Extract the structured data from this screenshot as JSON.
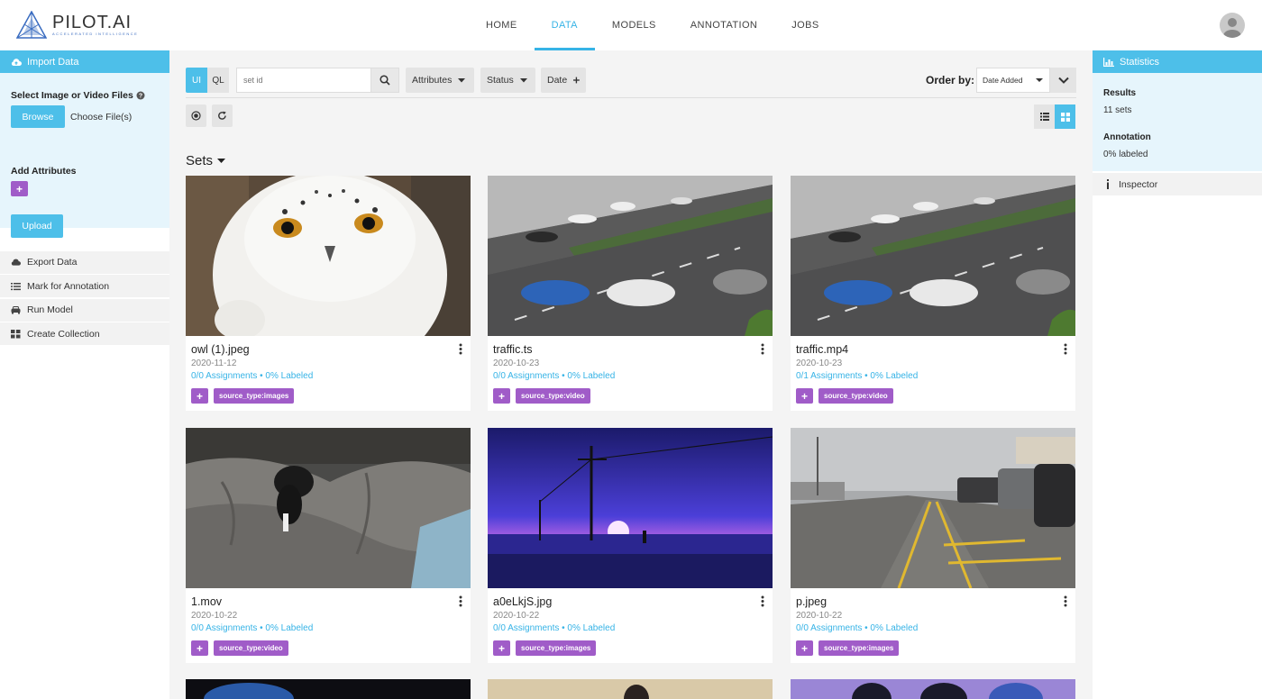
{
  "app": {
    "title": "PILOT.AI",
    "subtitle": "ACCELERATED INTELLIGENCE"
  },
  "nav": [
    {
      "label": "HOME"
    },
    {
      "label": "DATA"
    },
    {
      "label": "MODELS"
    },
    {
      "label": "ANNOTATION"
    },
    {
      "label": "JOBS"
    }
  ],
  "left": {
    "import_label": "Import Data",
    "select_label": "Select Image or Video Files",
    "browse_label": "Browse",
    "choose_label": "Choose File(s)",
    "add_attr_label": "Add Attributes",
    "add_attr_plus": "+",
    "upload_label": "Upload",
    "items": [
      {
        "label": "Export Data",
        "icon": "cloud-download-icon"
      },
      {
        "label": "Mark for Annotation",
        "icon": "list-icon"
      },
      {
        "label": "Run Model",
        "icon": "car-icon"
      },
      {
        "label": "Create Collection",
        "icon": "grid-icon"
      }
    ]
  },
  "toolbar": {
    "mode_ui": "UI",
    "mode_ql": "QL",
    "search_placeholder": "set id",
    "attributes_label": "Attributes",
    "status_label": "Status",
    "date_label": "Date",
    "order_label": "Order by:",
    "order_value": "Date Added"
  },
  "sets_heading": "Sets",
  "cards": [
    {
      "title": "owl (1).jpeg",
      "date": "2020-11-12",
      "stats": "0/0 Assignments • 0% Labeled",
      "tag": "source_type:images",
      "plus": "+"
    },
    {
      "title": "traffic.ts",
      "date": "2020-10-23",
      "stats": "0/0 Assignments • 0% Labeled",
      "tag": "source_type:video",
      "plus": "+"
    },
    {
      "title": "traffic.mp4",
      "date": "2020-10-23",
      "stats": "0/1 Assignments • 0% Labeled",
      "tag": "source_type:video",
      "plus": "+"
    },
    {
      "title": "1.mov",
      "date": "2020-10-22",
      "stats": "0/0 Assignments • 0% Labeled",
      "tag": "source_type:video",
      "plus": "+"
    },
    {
      "title": "a0eLkjS.jpg",
      "date": "2020-10-22",
      "stats": "0/0 Assignments • 0% Labeled",
      "tag": "source_type:images",
      "plus": "+"
    },
    {
      "title": "p.jpeg",
      "date": "2020-10-22",
      "stats": "0/0 Assignments • 0% Labeled",
      "tag": "source_type:images",
      "plus": "+"
    }
  ],
  "right": {
    "stats_label": "Statistics",
    "results_h": "Results",
    "results_v": "11 sets",
    "annotation_h": "Annotation",
    "annotation_v": "0% labeled",
    "inspector_label": "Inspector"
  },
  "colors": {
    "accent": "#4dbfe9",
    "tag": "#a05cc8",
    "link": "#36b3e6"
  }
}
